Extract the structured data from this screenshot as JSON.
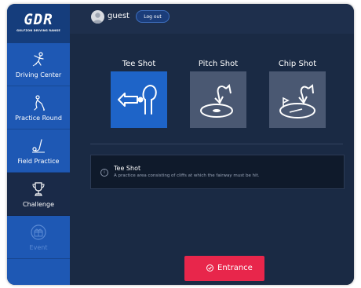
{
  "app": {
    "logo_text": "GDR",
    "logo_subtitle": "GOLFZON DRIVING RANGE",
    "colors": {
      "sidebar": "#1e58b4",
      "accent_red": "#e8264b",
      "selected_tile": "#1e64c8"
    }
  },
  "header": {
    "username": "guest",
    "logout_label": "Log out"
  },
  "sidebar": {
    "items": [
      {
        "label": "Driving Center",
        "icon": "golfer-swing-icon",
        "state": "normal"
      },
      {
        "label": "Practice Round",
        "icon": "golfer-putt-icon",
        "state": "normal"
      },
      {
        "label": "Field Practice",
        "icon": "golf-club-ball-icon",
        "state": "normal"
      },
      {
        "label": "Challenge",
        "icon": "trophy-icon",
        "state": "active"
      },
      {
        "label": "Event",
        "icon": "gift-icon",
        "state": "disabled"
      }
    ]
  },
  "shots": [
    {
      "label": "Tee Shot",
      "icon": "tee-shot-icon",
      "selected": true
    },
    {
      "label": "Pitch Shot",
      "icon": "pitch-shot-icon",
      "selected": false
    },
    {
      "label": "Chip Shot",
      "icon": "chip-shot-icon",
      "selected": false
    }
  ],
  "info": {
    "title": "Tee Shot",
    "description": "A practice area consisting of cliffs at which the fairway must be hit."
  },
  "entrance_label": "Entrance"
}
